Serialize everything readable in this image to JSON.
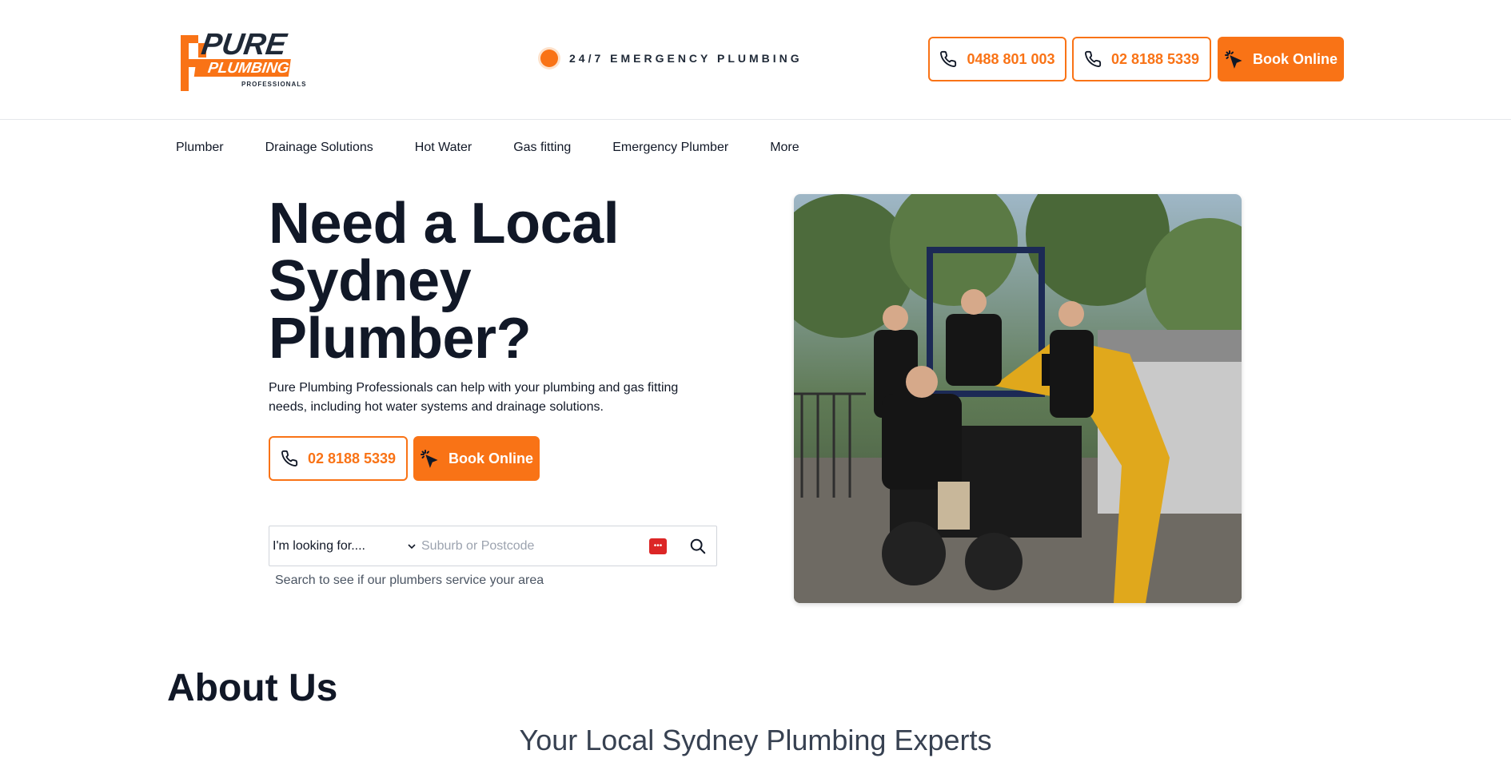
{
  "brand": {
    "logo_word1": "PURE",
    "logo_word2": "PLUMBING",
    "logo_word3": "PROFESSIONALS",
    "accent_color": "#f97316",
    "text_color": "#111827"
  },
  "header": {
    "emergency_label": "24/7 EMERGENCY PLUMBING",
    "phone_mobile": "0488 801 003",
    "phone_landline": "02 8188 5339",
    "book_label": "Book Online"
  },
  "nav": {
    "items": [
      {
        "label": "Plumber"
      },
      {
        "label": "Drainage Solutions"
      },
      {
        "label": "Hot Water"
      },
      {
        "label": "Gas fitting"
      },
      {
        "label": "Emergency Plumber"
      },
      {
        "label": "More"
      }
    ]
  },
  "hero": {
    "title": "Need a Local Sydney Plumber?",
    "description": "Pure Plumbing Professionals can help with your plumbing and gas fitting needs, including hot water systems and drainage solutions.",
    "phone_label": "02 8188 5339",
    "book_label": "Book Online"
  },
  "search": {
    "service_selected": "I'm looking for....",
    "location_placeholder": "Suburb or Postcode",
    "hint": "Search to see if our plumbers service your area"
  },
  "about": {
    "title": "About Us",
    "subtitle": "Your Local Sydney Plumbing Experts"
  },
  "icons": {
    "phone": "phone-icon",
    "pointer": "click-pointer-icon",
    "search": "search-icon",
    "chevron": "chevron-down-icon",
    "password_manager": "password-manager-icon"
  }
}
